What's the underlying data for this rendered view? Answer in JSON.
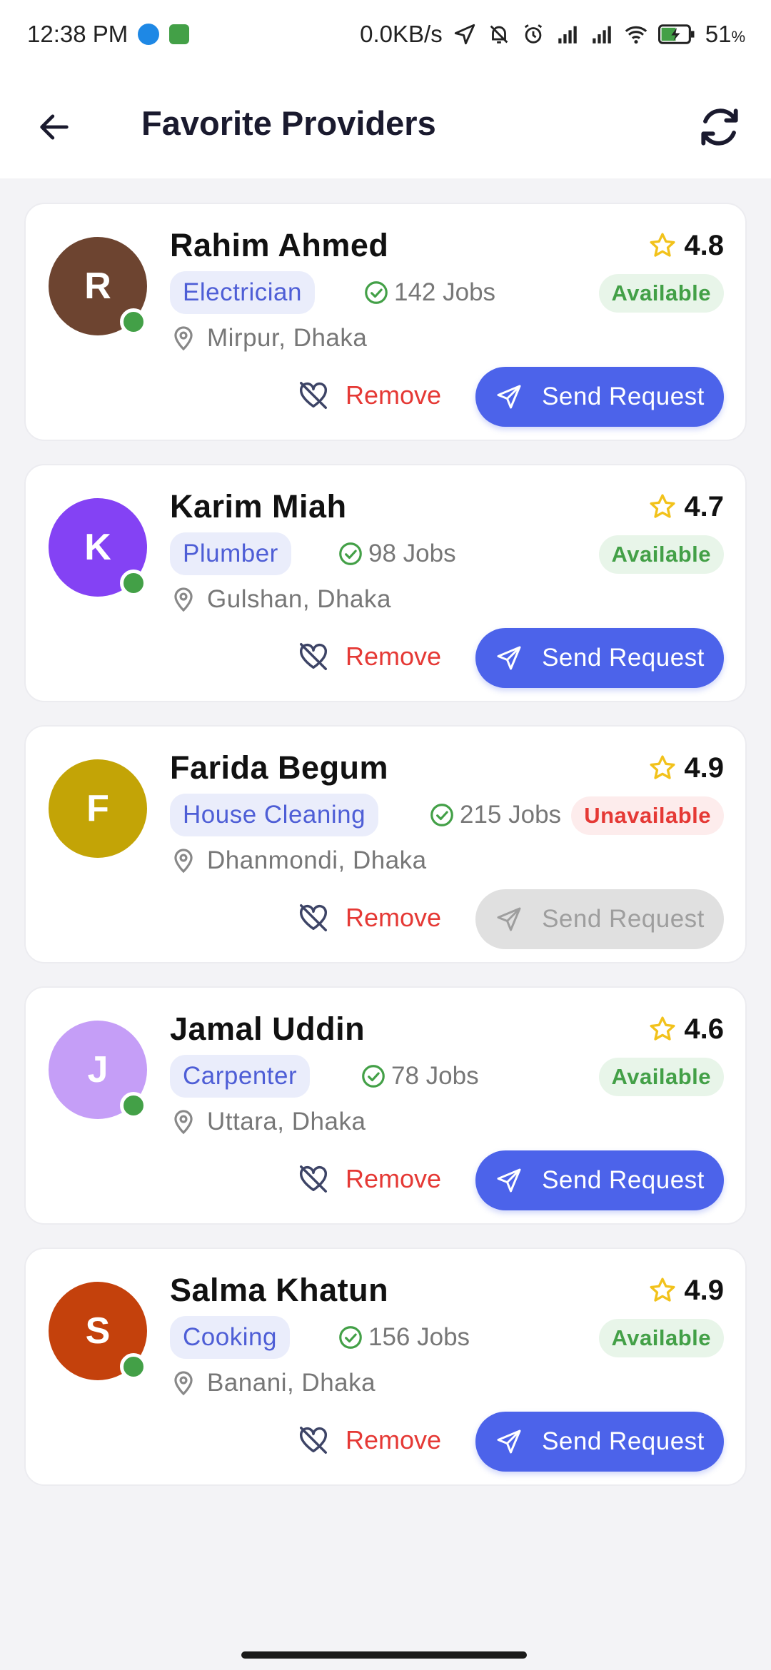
{
  "status_bar": {
    "time": "12:38 PM",
    "network_speed": "0.0KB/s",
    "battery": "51",
    "battery_unit": "%"
  },
  "app_bar": {
    "title": "Favorite Providers",
    "back_icon": "arrow-left-icon",
    "refresh_icon": "refresh-icon"
  },
  "colors": {
    "primary": "#4c63ea",
    "available": "#43a047",
    "unavailable": "#e53935",
    "star": "#f2c21b"
  },
  "providers": [
    {
      "initial": "R",
      "avatar_color": "#6d4430",
      "online": true,
      "name": "Rahim Ahmed",
      "rating": "4.8",
      "category": "Electrician",
      "jobs": "142 Jobs",
      "status": "Available",
      "available": true,
      "location": "Mirpur, Dhaka",
      "remove_label": "Remove",
      "send_label": "Send Request"
    },
    {
      "initial": "K",
      "avatar_color": "#8442f4",
      "online": true,
      "name": "Karim Miah",
      "rating": "4.7",
      "category": "Plumber",
      "jobs": "98 Jobs",
      "status": "Available",
      "available": true,
      "location": "Gulshan, Dhaka",
      "remove_label": "Remove",
      "send_label": "Send Request"
    },
    {
      "initial": "F",
      "avatar_color": "#c3a406",
      "online": false,
      "name": "Farida Begum",
      "rating": "4.9",
      "category": "House Cleaning",
      "jobs": "215 Jobs",
      "status": "Unavailable",
      "available": false,
      "location": "Dhanmondi, Dhaka",
      "remove_label": "Remove",
      "send_label": "Send Request"
    },
    {
      "initial": "J",
      "avatar_color": "#c59ef7",
      "online": true,
      "name": "Jamal Uddin",
      "rating": "4.6",
      "category": "Carpenter",
      "jobs": "78 Jobs",
      "status": "Available",
      "available": true,
      "location": "Uttara, Dhaka",
      "remove_label": "Remove",
      "send_label": "Send Request"
    },
    {
      "initial": "S",
      "avatar_color": "#c4410c",
      "online": true,
      "name": "Salma Khatun",
      "rating": "4.9",
      "category": "Cooking",
      "jobs": "156 Jobs",
      "status": "Available",
      "available": true,
      "location": "Banani, Dhaka",
      "remove_label": "Remove",
      "send_label": "Send Request"
    }
  ]
}
